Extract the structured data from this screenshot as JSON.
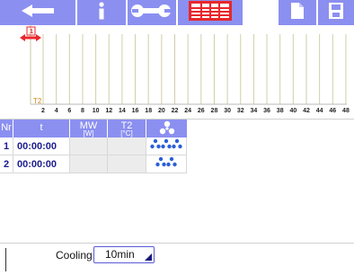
{
  "toolbar": {
    "icons": [
      "back-arrow-icon",
      "info-icon",
      "wrench-icon",
      "table-grid-icon",
      "document-icon",
      "save-disk-icon"
    ],
    "active_icon": "table-grid-icon",
    "colors": {
      "bar": "#8b8ff0",
      "active": "#e8272b"
    }
  },
  "graph": {
    "series_label": "T2",
    "x_ticks": [
      "2",
      "4",
      "6",
      "8",
      "10",
      "12",
      "14",
      "16",
      "18",
      "20",
      "22",
      "24",
      "26",
      "28",
      "30",
      "32",
      "34",
      "36",
      "38",
      "40",
      "42",
      "44",
      "46",
      "48"
    ],
    "marker_label": "1",
    "marker_color": "#e8272b"
  },
  "table": {
    "columns": [
      {
        "label": "Nr",
        "unit": ""
      },
      {
        "label": "t",
        "unit": ""
      },
      {
        "label": "MW",
        "unit": "[W]"
      },
      {
        "label": "T2",
        "unit": "[°C]"
      },
      {
        "label": "",
        "unit": "",
        "icon": "fan-icon"
      }
    ],
    "rows": [
      {
        "nr": "1",
        "t": "00:00:00",
        "mw": "",
        "t2": "",
        "fan_count": 3
      },
      {
        "nr": "2",
        "t": "00:00:00",
        "mw": "",
        "t2": "",
        "fan_count": 2
      }
    ]
  },
  "bottom": {
    "mode_label": "Cooling",
    "interval_value": "10min"
  }
}
